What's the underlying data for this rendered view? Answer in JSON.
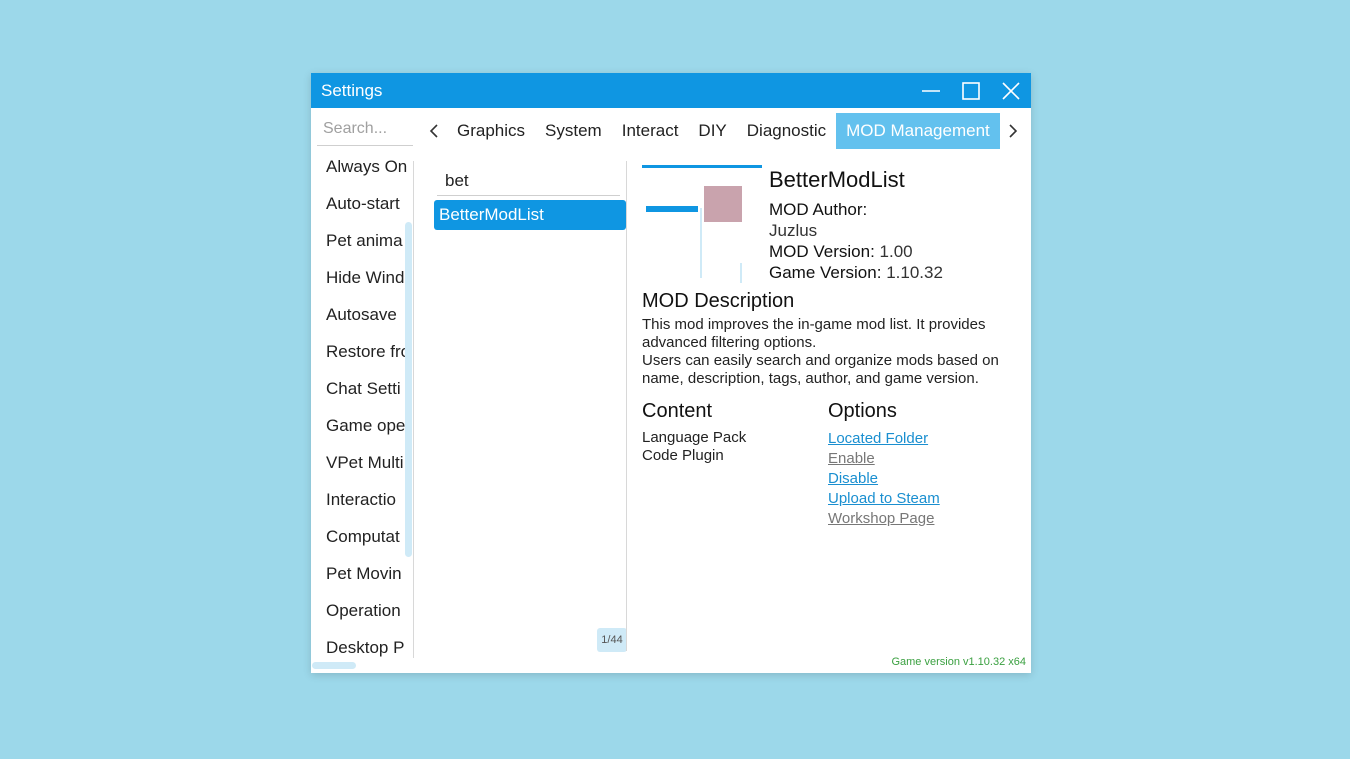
{
  "window": {
    "title": "Settings"
  },
  "sidebar": {
    "search_placeholder": "Search...",
    "items": [
      "Always On",
      "Auto-start",
      "Pet anima",
      "Hide Wind",
      "Autosave",
      "Restore fro",
      "Chat Setti",
      "Game ope",
      "VPet Multi",
      "Interactio",
      "Computat",
      "Pet Movin",
      "Operation",
      "Desktop P"
    ]
  },
  "tabs": [
    "Graphics",
    "System",
    "Interact",
    "DIY",
    "Diagnostic",
    "MOD Management"
  ],
  "mod_list": {
    "search_value": "bet",
    "selected_item": "BetterModList",
    "count": "1/44"
  },
  "details": {
    "name": "BetterModList",
    "author_label": "MOD Author:",
    "author_value": "Juzlus",
    "version_label": "MOD Version:",
    "version_value": "1.00",
    "game_version_label": "Game Version:",
    "game_version_value": "1.10.32",
    "description_heading": "MOD Description",
    "description_lines": [
      "This mod improves the in-game mod list. It provides advanced filtering options.",
      "Users can easily search and organize mods based on name, description, tags, author, and game version."
    ],
    "content_heading": "Content",
    "content_items": [
      "Language Pack",
      "Code Plugin"
    ],
    "options_heading": "Options",
    "options": [
      "Located Folder",
      "Enable",
      "Disable",
      "Upload to Steam",
      "Workshop Page"
    ]
  },
  "footer": {
    "version_text": "Game version v1.10.32 x64"
  },
  "colors": {
    "accent": "#0f96e2",
    "tab_active": "#63c1ee",
    "background": "#9cd8ea",
    "footer_text": "#3aa040"
  }
}
